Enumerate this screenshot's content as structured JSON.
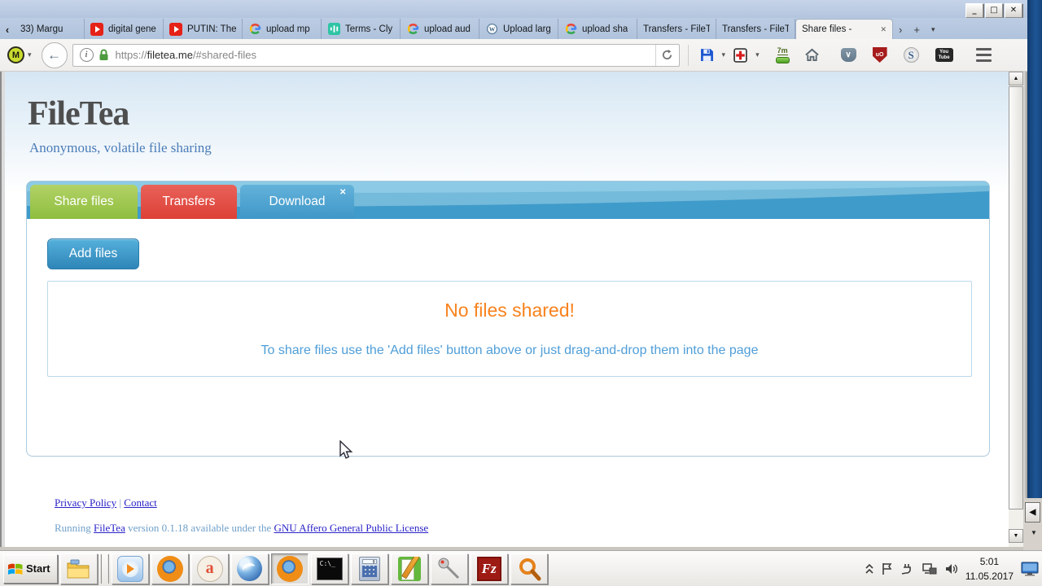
{
  "titlebar": {
    "minimize": "_",
    "maximize": "□",
    "close": "✕"
  },
  "tabstrip": {
    "scroll_left": "‹",
    "scroll_right": "›",
    "new_tab": "+",
    "all_tabs": "▾",
    "tab_close": "✕",
    "tabs": [
      {
        "label": "33) Margu"
      },
      {
        "label": "digital gene"
      },
      {
        "label": "PUTIN: The"
      },
      {
        "label": "upload mp"
      },
      {
        "label": "Terms - Cly"
      },
      {
        "label": "upload aud"
      },
      {
        "label": "Upload larg"
      },
      {
        "label": "upload sha"
      },
      {
        "label": "Transfers - FileT"
      },
      {
        "label": "Transfers - FileT"
      },
      {
        "label": "Share files - "
      }
    ]
  },
  "toolbar": {
    "m_label": "M",
    "caret": "▾",
    "back_arrow": "←",
    "info_label": "i",
    "url_scheme": "https://",
    "url_host": "filetea.me",
    "url_path": "/#shared-files",
    "timer_badge": "7m",
    "ublock_label": "uO",
    "s_label": "S",
    "yt_line1": "You",
    "yt_line2": "Tube",
    "pocket_chevron": "∨"
  },
  "page": {
    "brand_title": "FileTea",
    "brand_tagline": "Anonymous, volatile file sharing",
    "tab_share": "Share files",
    "tab_transfers": "Transfers",
    "tab_download": "Download",
    "tab_close": "✕",
    "add_files": "Add files",
    "empty_title": "No files shared!",
    "empty_hint": "To share files use the 'Add files' button above or just drag-and-drop them into the page",
    "footer_link_privacy": "Privacy Policy",
    "footer_sep": " | ",
    "footer_link_contact": "Contact",
    "running_prefix": "Running ",
    "running_link1": "FileTea",
    "running_mid": " version 0.1.18 available under the ",
    "running_link2": "GNU Affero General Public License"
  },
  "scrollbar": {
    "up": "▲",
    "down": "▼"
  },
  "background_window": {
    "button": "◀",
    "small_arrow": "▼"
  },
  "taskbar": {
    "start": "Start",
    "cmd_text": "C:\\_",
    "calc_display": "0",
    "audio_label": "a",
    "filezilla_label": "Fz",
    "clock_time": "5:01",
    "clock_date": "11.05.2017"
  },
  "colors": {
    "accent_blue": "#3f9bca",
    "tab_green": "#9bc24e",
    "tab_red": "#e04a40",
    "empty_orange": "#f8821c",
    "hint_blue": "#4f9ed8",
    "link_blue": "#2a23c7"
  }
}
